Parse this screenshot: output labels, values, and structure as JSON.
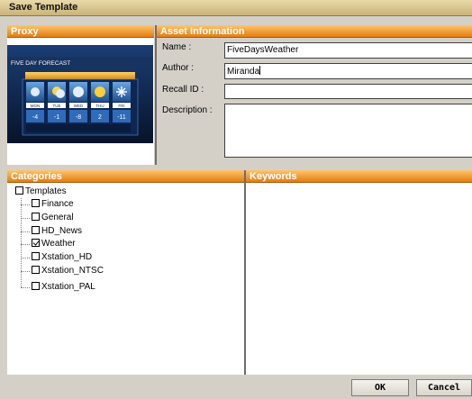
{
  "window": {
    "title": "Save Template"
  },
  "proxy": {
    "header": "Proxy",
    "thumbnail_caption": "FIVE DAY FORECAST",
    "days": [
      "MON",
      "TUE",
      "WED",
      "THU",
      "FRI"
    ],
    "temps": [
      "-4",
      "-1",
      "-8",
      "2",
      "-11"
    ],
    "weather_icons": [
      "snow-icon",
      "sun-cloud-icon",
      "cloud-snow-icon",
      "sun-icon",
      "snowflake-icon"
    ]
  },
  "asset": {
    "header": "Asset Information",
    "name_label": "Name :",
    "name_value": "FiveDaysWeather",
    "author_label": "Author :",
    "author_value": "Miranda",
    "recall_label": "Recall ID :",
    "recall_value": "",
    "description_label": "Description :",
    "description_value": ""
  },
  "categories": {
    "header": "Categories",
    "root": {
      "label": "Templates",
      "checked": false
    },
    "items": [
      {
        "label": "Finance",
        "checked": false
      },
      {
        "label": "General",
        "checked": false
      },
      {
        "label": "HD_News",
        "checked": false
      },
      {
        "label": "Weather",
        "checked": true
      },
      {
        "label": "Xstation_HD",
        "checked": false
      },
      {
        "label": "Xstation_NTSC",
        "checked": false
      },
      {
        "label": "Xstation_PAL",
        "checked": false
      }
    ]
  },
  "keywords": {
    "header": "Keywords"
  },
  "buttons": {
    "ok": "OK",
    "cancel": "Cancel"
  },
  "colors": {
    "section_header": "#e37d12",
    "title_bar": "#c9b479",
    "panel_bg": "#d4d0c8"
  }
}
